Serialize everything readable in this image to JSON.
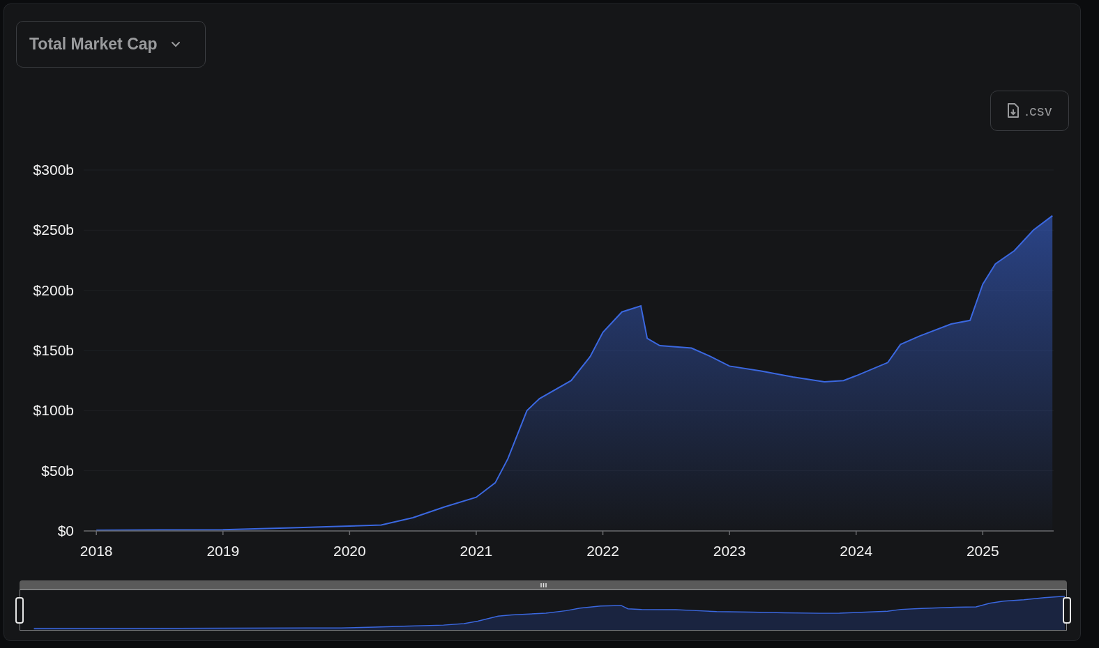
{
  "metric_dropdown": {
    "label": "Total Market Cap"
  },
  "csv_button": {
    "label": ".csv"
  },
  "chart": {
    "chart_data": {
      "type": "area",
      "xlim": [
        2017.9,
        2025.56
      ],
      "ylim": [
        0,
        300
      ],
      "xticks": [
        {
          "value": 2018,
          "label": "2018"
        },
        {
          "value": 2019,
          "label": "2019"
        },
        {
          "value": 2020,
          "label": "2020"
        },
        {
          "value": 2021,
          "label": "2021"
        },
        {
          "value": 2022,
          "label": "2022"
        },
        {
          "value": 2023,
          "label": "2023"
        },
        {
          "value": 2024,
          "label": "2024"
        },
        {
          "value": 2025,
          "label": "2025"
        }
      ],
      "yticks": [
        {
          "value": 0,
          "label": "$0"
        },
        {
          "value": 50,
          "label": "$50b"
        },
        {
          "value": 100,
          "label": "$100b"
        },
        {
          "value": 150,
          "label": "$150b"
        },
        {
          "value": 200,
          "label": "$200b"
        },
        {
          "value": 250,
          "label": "$250b"
        },
        {
          "value": 300,
          "label": "$300b"
        }
      ],
      "x": [
        2018.0,
        2018.5,
        2019.0,
        2019.5,
        2020.0,
        2020.25,
        2020.5,
        2020.75,
        2021.0,
        2021.15,
        2021.25,
        2021.4,
        2021.5,
        2021.75,
        2021.9,
        2022.0,
        2022.15,
        2022.3,
        2022.35,
        2022.45,
        2022.7,
        2022.85,
        2023.0,
        2023.25,
        2023.5,
        2023.75,
        2023.9,
        2024.0,
        2024.25,
        2024.35,
        2024.5,
        2024.75,
        2024.9,
        2025.0,
        2025.1,
        2025.25,
        2025.4,
        2025.55
      ],
      "grid": true,
      "series": [
        {
          "color": "#3b68e0",
          "values": [
            0.5,
            0.8,
            1,
            2.5,
            4,
            5,
            11,
            20,
            28,
            40,
            60,
            100,
            110,
            125,
            145,
            165,
            182,
            187,
            160,
            154,
            152,
            145,
            137,
            133,
            128,
            124,
            125,
            129,
            140,
            155,
            162,
            172,
            175,
            205,
            222,
            233,
            250,
            262
          ]
        }
      ]
    }
  }
}
